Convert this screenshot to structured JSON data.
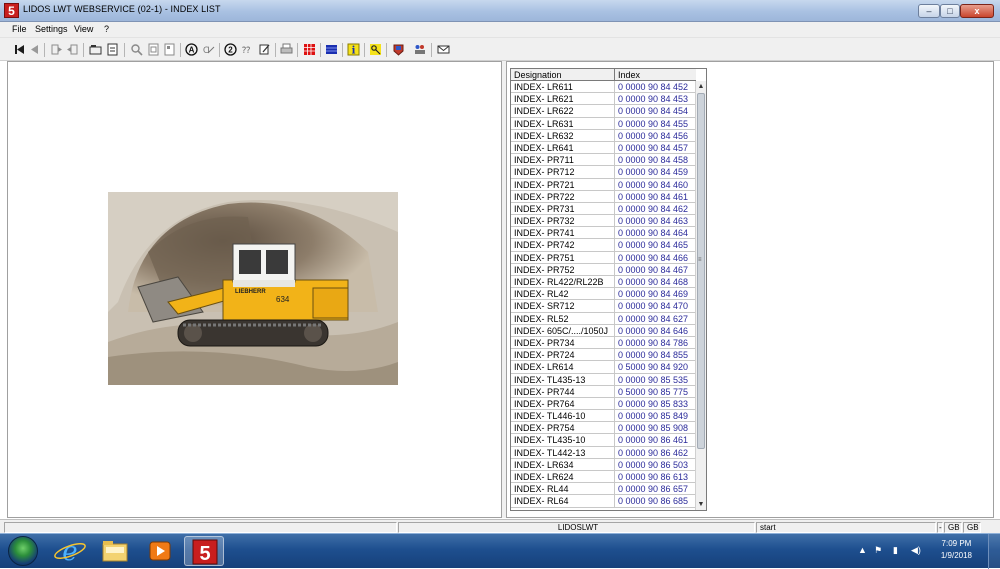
{
  "window": {
    "title": "LIDOS LWT WEBSERVICE (02-1) - INDEX LIST",
    "app_icon_text": "5",
    "minimize": "–",
    "maximize": "□",
    "close": "x"
  },
  "menu": [
    "File",
    "Settings",
    "View",
    "?"
  ],
  "toolbar_icons": [
    "first-record-icon",
    "previous-record-icon",
    "next-record-icon",
    "last-record-icon",
    "folder-icon",
    "checklist-icon",
    "zoom-icon",
    "page-icon",
    "pages-icon",
    "search-a-icon",
    "cross-ref-icon",
    "info-2-icon",
    "note-icon",
    "edit-icon",
    "print-icon",
    "table-icon",
    "grid-icon",
    "info-icon",
    "key-icon",
    "badge-icon",
    "users-icon",
    "mail-icon"
  ],
  "table": {
    "columns": [
      "Designation",
      "Index"
    ],
    "rows": [
      [
        "INDEX- LR611",
        "0 0000 90 84 452"
      ],
      [
        "INDEX- LR621",
        "0 0000 90 84 453"
      ],
      [
        "INDEX- LR622",
        "0 0000 90 84 454"
      ],
      [
        "INDEX- LR631",
        "0 0000 90 84 455"
      ],
      [
        "INDEX- LR632",
        "0 0000 90 84 456"
      ],
      [
        "INDEX- LR641",
        "0 0000 90 84 457"
      ],
      [
        "INDEX- PR711",
        "0 0000 90 84 458"
      ],
      [
        "INDEX- PR712",
        "0 0000 90 84 459"
      ],
      [
        "INDEX- PR721",
        "0 0000 90 84 460"
      ],
      [
        "INDEX- PR722",
        "0 0000 90 84 461"
      ],
      [
        "INDEX- PR731",
        "0 0000 90 84 462"
      ],
      [
        "INDEX- PR732",
        "0 0000 90 84 463"
      ],
      [
        "INDEX- PR741",
        "0 0000 90 84 464"
      ],
      [
        "INDEX- PR742",
        "0 0000 90 84 465"
      ],
      [
        "INDEX- PR751",
        "0 0000 90 84 466"
      ],
      [
        "INDEX- PR752",
        "0 0000 90 84 467"
      ],
      [
        "INDEX- RL422/RL22B",
        "0 0000 90 84 468"
      ],
      [
        "INDEX- RL42",
        "0 0000 90 84 469"
      ],
      [
        "INDEX- SR712",
        "0 0000 90 84 470"
      ],
      [
        "INDEX- RL52",
        "0 0000 90 84 627"
      ],
      [
        "INDEX- 605C/..../1050J",
        "0 0000 90 84 646"
      ],
      [
        "INDEX- PR734",
        "0 0000 90 84 786"
      ],
      [
        "INDEX- PR724",
        "0 0000 90 84 855"
      ],
      [
        "INDEX- LR614",
        "0 5000 90 84 920"
      ],
      [
        "INDEX- TL435-13",
        "0 0000 90 85 535"
      ],
      [
        "INDEX- PR744",
        "0 5000 90 85 775"
      ],
      [
        "INDEX- PR764",
        "0 0000 90 85 833"
      ],
      [
        "INDEX- TL446-10",
        "0 0000 90 85 849"
      ],
      [
        "INDEX- PR754",
        "0 0000 90 85 908"
      ],
      [
        "INDEX- TL435-10",
        "0 0000 90 86 461"
      ],
      [
        "INDEX- TL442-13",
        "0 0000 90 86 462"
      ],
      [
        "INDEX- LR634",
        "0 0000 90 86 503"
      ],
      [
        "INDEX- LR624",
        "0 0000 90 86 613"
      ],
      [
        "INDEX- RL44",
        "0 0000 90 86 657"
      ],
      [
        "INDEX- RL64",
        "0 0000 90 86 685"
      ]
    ]
  },
  "image": {
    "brand_text": "LIEBHERR",
    "model_text": "634"
  },
  "statusbar": {
    "center": "LIDOSLWT",
    "right": "start",
    "gb1": "GB",
    "gb2": "GB",
    "dash": "-"
  },
  "taskbar": {
    "items": [
      "start-orb",
      "internet-explorer-icon",
      "file-explorer-icon",
      "media-player-icon",
      "lidos-app-icon"
    ],
    "time": "7:09 PM",
    "date": "1/9/2018"
  }
}
